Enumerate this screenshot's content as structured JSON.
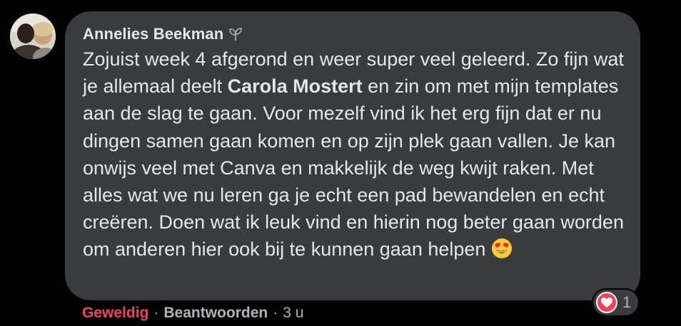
{
  "comment": {
    "author": "Annelies Beekman",
    "author_badge_icon": "sprout-icon",
    "text_before_mention": "Zojuist week 4 afgerond en weer super veel geleerd. Zo fijn wat je allemaal deelt ",
    "mention": "Carola Mostert",
    "text_after_mention": " en zin om met mijn templates aan de slag te gaan. Voor mezelf vind ik het erg fijn dat er nu dingen samen gaan komen en op zijn plek gaan vallen. Je kan onwijs veel met Canva en makkelijk de weg kwijt raken. Met alles wat we nu leren ga je echt een pad bewandelen en echt creëren. Doen wat ik leuk vind en hierin nog beter gaan worden om anderen hier ook bij te kunnen gaan helpen ",
    "trailing_emoji": "heart-eyes-emoji"
  },
  "reactions": {
    "icon": "love-reaction-icon",
    "count": "1"
  },
  "actions": {
    "reaction_label": "Geweldig",
    "reply_label": "Beantwoorden",
    "separator": "·",
    "timestamp": "3 u"
  },
  "colors": {
    "background": "#000000",
    "bubble": "#3a3b3c",
    "text": "#e4e6eb",
    "muted": "#b0b3b8",
    "love": "#f3425f"
  }
}
